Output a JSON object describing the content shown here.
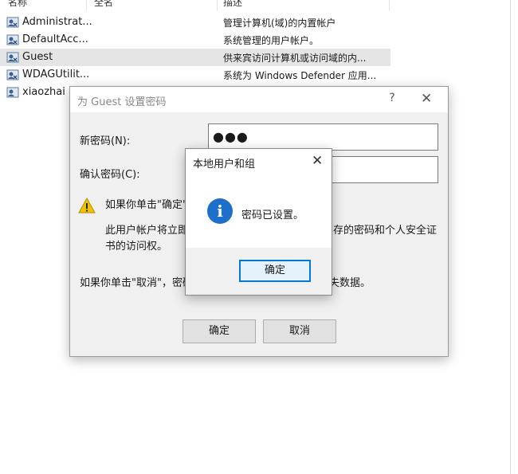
{
  "list": {
    "columns": [
      "名称",
      "全名",
      "描述"
    ],
    "rows": [
      {
        "name": "Administrat...",
        "description": "管理计算机(域)的内置帐户"
      },
      {
        "name": "DefaultAcc...",
        "description": "系统管理的用户帐户。"
      },
      {
        "name": "Guest",
        "description": "供来宾访问计算机或访问域的内..."
      },
      {
        "name": "WDAGUtilit...",
        "description": "系统为 Windows Defender 应用..."
      },
      {
        "name": "xiaozhai",
        "description": ""
      }
    ]
  },
  "password_dialog": {
    "title": "为 Guest 设置密码",
    "help": "?",
    "new_password_label": "新密码(N):",
    "new_password_value": "●●●",
    "confirm_password_label": "确认密码(C):",
    "warning_line1": "如果你单击\"确定\"",
    "warning_line2_left": "此用户帐户将立即",
    "warning_line2_right": "存的密码和个人安全证",
    "warning_line3": "书的访问权。",
    "cancel_note_left": "如果你单击\"取消\"，密码",
    "cancel_note_right": "失数据。",
    "ok_label": "确定",
    "cancel_label": "取消"
  },
  "message_box": {
    "title": "本地用户和组",
    "message": "密码已设置。",
    "ok_label": "确定"
  },
  "colors": {
    "info_icon": "#1e6fc9",
    "warning_icon": "#f2c200",
    "default_button_border": "#0078d7"
  }
}
